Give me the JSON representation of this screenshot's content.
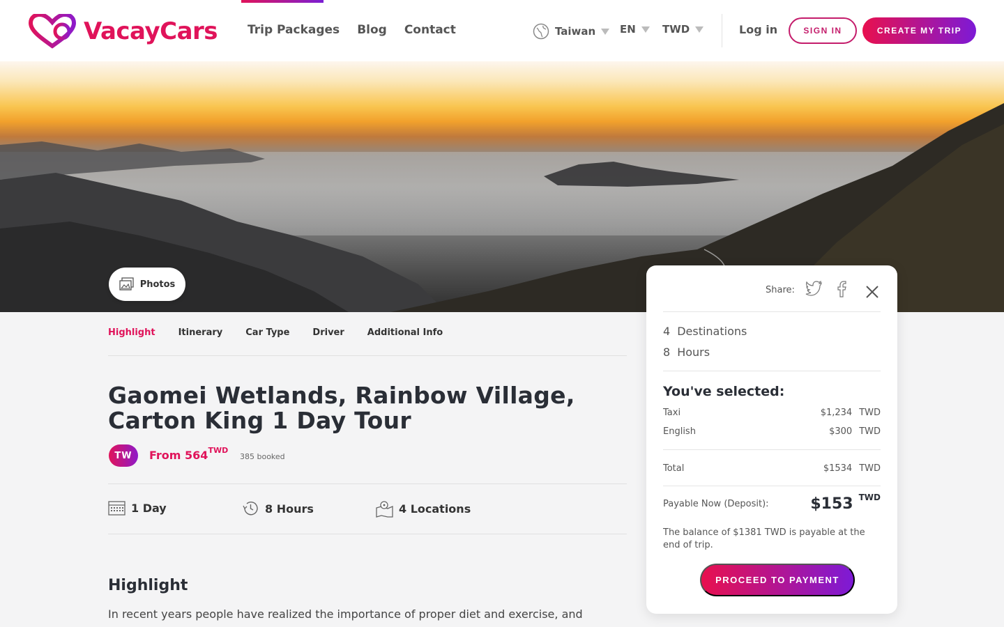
{
  "brand": {
    "name": "VacayCars",
    "color": "#e0135a"
  },
  "nav": {
    "items": [
      "Trip Packages",
      "Blog",
      "Contact"
    ]
  },
  "selectors": {
    "country": "Taiwan",
    "language": "EN",
    "currency": "TWD"
  },
  "auth": {
    "login": "Log in",
    "signin": "SIGN IN",
    "create": "CREATE MY TRIP"
  },
  "hero": {
    "photos_label": "Photos"
  },
  "tabs": [
    "Highlight",
    "Itinerary",
    "Car Type",
    "Driver",
    "Additional Info"
  ],
  "tour": {
    "title": "Gaomei Wetlands, Rainbow Village, Carton King 1 Day Tour",
    "country_badge": "TW",
    "from_label": "From 564",
    "from_currency": "TWD",
    "booked": "385 booked",
    "duration_days": "1 Day",
    "duration_hours": "8 Hours",
    "locations": "4 Locations"
  },
  "highlight": {
    "heading": "Highlight",
    "text": "In recent years people have realized the importance of proper diet and exercise, and"
  },
  "card": {
    "share_label": "Share:",
    "destinations_num": "4",
    "destinations_label": "Destinations",
    "hours_num": "8",
    "hours_label": "Hours",
    "selected_heading": "You've selected:",
    "items": [
      {
        "label": "Taxi",
        "amount": "$1,234",
        "currency": "TWD"
      },
      {
        "label": "English",
        "amount": "$300",
        "currency": "TWD"
      }
    ],
    "total_label": "Total",
    "total_amount": "$1534",
    "total_currency": "TWD",
    "payable_label": "Payable Now (Deposit):",
    "payable_amount": "$153",
    "payable_currency": "TWD",
    "balance_note": "The balance of $1381 TWD is payable at the end of trip.",
    "proceed": "PROCEED TO PAYMENT"
  },
  "colors": {
    "accent": "#e0135a",
    "gradient_end": "#7d1ad6",
    "background": "#f4f4f5"
  }
}
